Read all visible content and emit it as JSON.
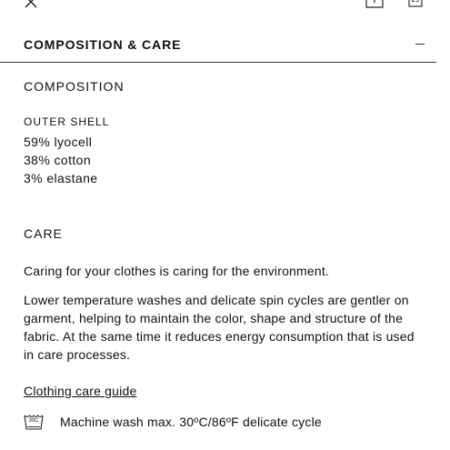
{
  "topbar": {
    "close_icon": "close-icon",
    "share_icon": "share-icon",
    "calendar_icon": "calendar-icon",
    "calendar_day": "29"
  },
  "section": {
    "title": "COMPOSITION & CARE",
    "toggle_icon": "minus-icon"
  },
  "composition": {
    "heading": "COMPOSITION",
    "part_label": "OUTER SHELL",
    "materials": [
      "59% lyocell",
      "38% cotton",
      "3% elastane"
    ]
  },
  "care": {
    "heading": "CARE",
    "intro": "Caring for your clothes is caring for the environment.",
    "body": "Lower temperature washes and delicate spin cycles are gentler on garment, helping to maintain the color, shape and structure of the fabric. At the same time it reduces energy consumption that is used in care processes.",
    "guide_link": "Clothing care guide",
    "instructions": [
      {
        "icon": "wash-30-icon",
        "icon_label": "30C",
        "text": "Machine wash max. 30ºC/86ºF delicate cycle"
      }
    ]
  }
}
